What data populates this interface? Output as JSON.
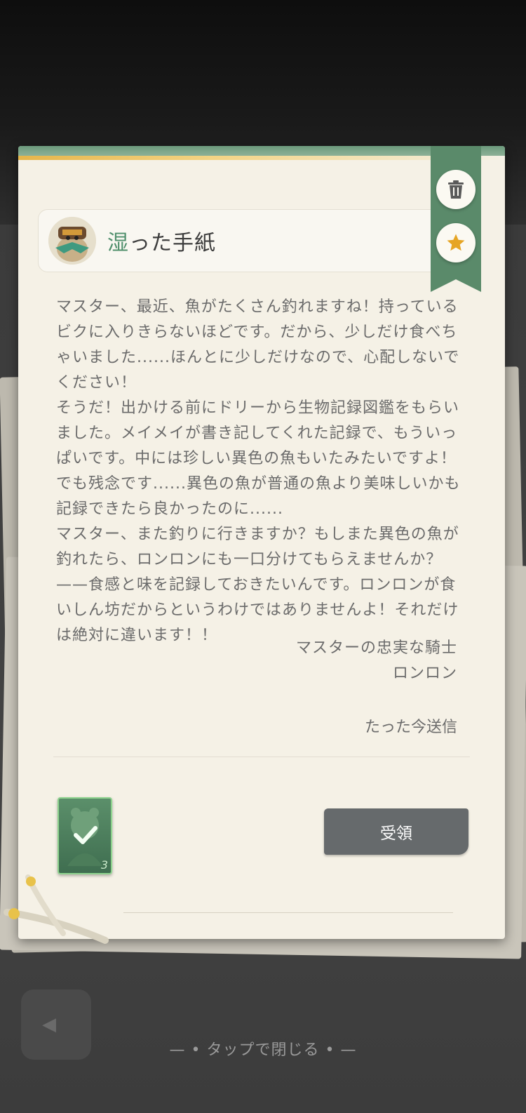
{
  "letter": {
    "title_accent": "湿",
    "title_rest": "った手紙",
    "paragraphs": [
      "マスター、最近、魚がたくさん釣れますね！持っているビクに入りきらないほどです。だから、少しだけ食べちゃいました......ほんとに少しだけなので、心配しないでください！",
      "そうだ！出かける前にドリーから生物記録図鑑をもらいました。メイメイが書き記してくれた記録で、もういっぱいです。中には珍しい異色の魚もいたみたいですよ！でも残念です......異色の魚が普通の魚より美味しいかも記録できたら良かったのに......",
      "マスター、また釣りに行きますか？もしまた異色の魚が釣れたら、ロンロンにも一口分けてもらえませんか？——食感と味を記録しておきたいんです。ロンロンが食いしん坊だからというわけではありませんよ！それだけは絶対に違います！！"
    ],
    "signature_line1": "マスターの忠実な騎士",
    "signature_line2": "ロンロン",
    "sent_time": "たった今送信",
    "attachment_count": "3",
    "receive_label": "受領"
  },
  "icons": {
    "delete": "trash-icon",
    "favorite": "star-icon",
    "attachment": "card-check-icon"
  },
  "close_hint": "タップで閉じる",
  "colors": {
    "accent_green": "#4f8f6c",
    "ribbon_green": "#5a8a6a",
    "star_gold": "#e6a524",
    "button_gray": "#666a6c"
  }
}
